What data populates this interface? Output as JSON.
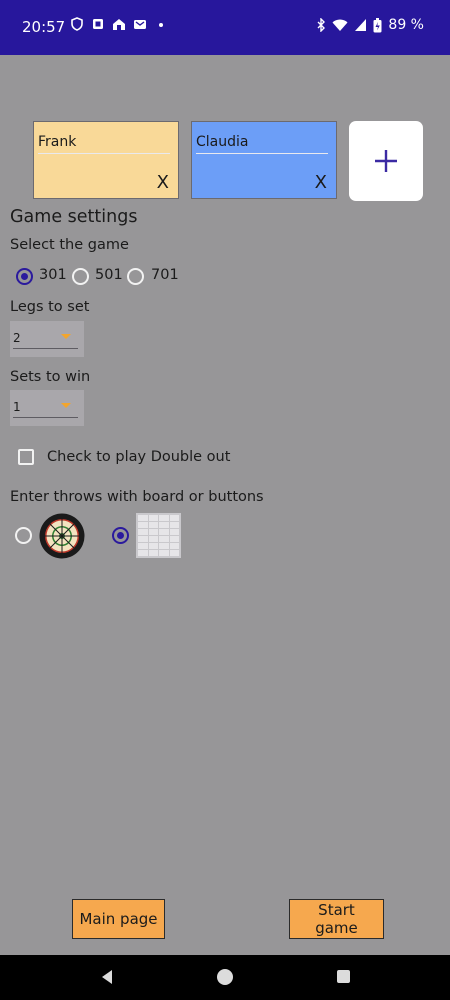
{
  "status_bar": {
    "time": "20:57",
    "battery": "89 %",
    "left_icons": [
      "vpn-shield-icon",
      "notification-app-icon",
      "home-app-icon",
      "message-app-icon",
      "dot-icon"
    ],
    "right_icons": [
      "bluetooth-icon",
      "wifi-icon",
      "signal-icon",
      "battery-icon"
    ]
  },
  "players": [
    {
      "name": "Frank",
      "remove_label": "X",
      "color": "#f9d998"
    },
    {
      "name": "Claudia",
      "remove_label": "X",
      "color": "#6c9ef7"
    }
  ],
  "add_player": {
    "icon": "plus-icon",
    "color": "#3b2aa3"
  },
  "settings": {
    "heading": "Game settings",
    "select_game_label": "Select the game",
    "game_options": [
      {
        "label": "301",
        "selected": true
      },
      {
        "label": "501",
        "selected": false
      },
      {
        "label": "701",
        "selected": false
      }
    ],
    "legs_label": "Legs to set",
    "legs_value": "2",
    "sets_label": "Sets to win",
    "sets_value": "1",
    "double_out_label": "Check to play Double out",
    "double_out_checked": false,
    "input_mode_label": "Enter throws with board or buttons",
    "input_modes": [
      {
        "icon": "dartboard-icon",
        "selected": false
      },
      {
        "icon": "keypad-icon",
        "selected": true
      }
    ]
  },
  "footer": {
    "main_page_label": "Main page",
    "start_game_label": "Start game",
    "button_color": "#f6a84e"
  },
  "nav_bar": {
    "icons": [
      "back-icon",
      "home-icon",
      "recent-apps-icon"
    ]
  },
  "colors": {
    "background": "#979698",
    "status_bar": "#27179c",
    "accent": "#2b1a9d"
  }
}
